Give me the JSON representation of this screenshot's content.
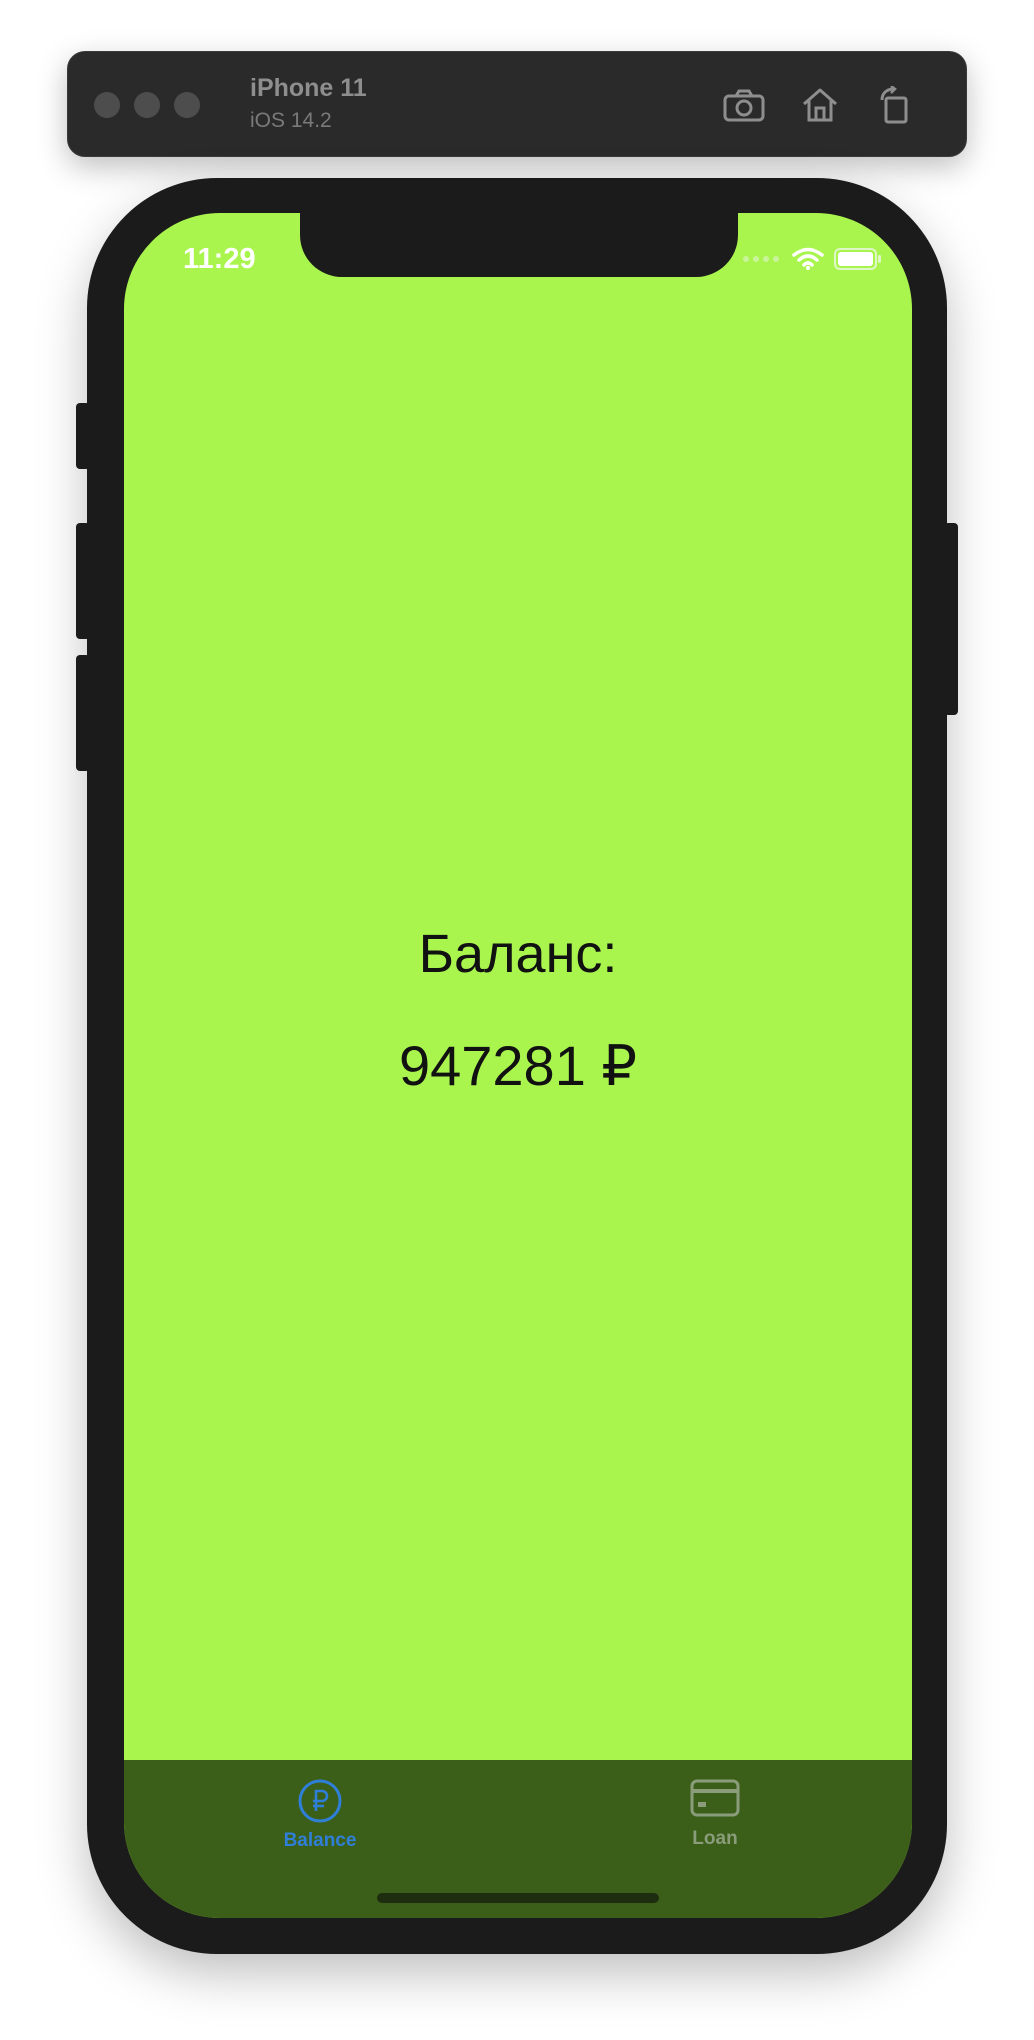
{
  "simulator": {
    "device_name": "iPhone 11",
    "os_version": "iOS 14.2",
    "buttons": {
      "screenshot_icon": "camera-icon",
      "home_icon": "home-icon",
      "rotate_icon": "rotate-icon"
    }
  },
  "status_bar": {
    "time": "11:29",
    "icons": [
      "cellular-signal-icon",
      "wifi-icon",
      "battery-icon"
    ]
  },
  "main": {
    "balance_label": "Баланс:",
    "balance_value": "947281 ₽",
    "background_color": "#a9f54e"
  },
  "tab_bar": {
    "background_color": "#3b5f19",
    "tabs": [
      {
        "label": "Balance",
        "icon": "ruble-circle-icon",
        "selected": true,
        "color": "#2f7fd8"
      },
      {
        "label": "Loan",
        "icon": "credit-card-icon",
        "selected": false,
        "color": "#8a9c7a"
      }
    ]
  }
}
